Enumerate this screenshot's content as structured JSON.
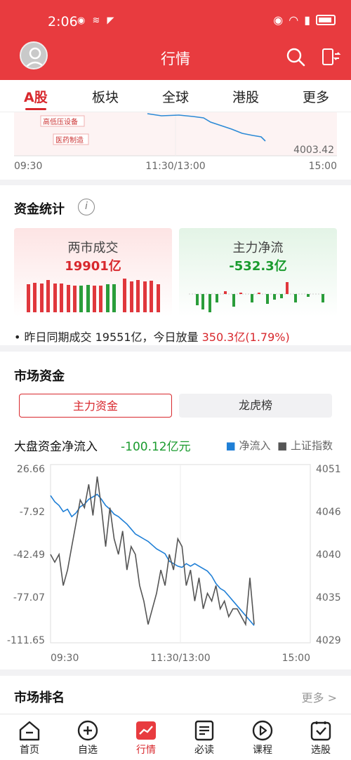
{
  "status_bar": {
    "time": "2:06"
  },
  "header": {
    "title": "行情"
  },
  "tabs": [
    "A股",
    "板块",
    "全球",
    "港股",
    "更多"
  ],
  "top_chart": {
    "tags": [
      "高低压设备",
      "医药制造"
    ],
    "low_label": "4003.42",
    "time_labels": [
      "09:30",
      "11:30/13:00",
      "15:00"
    ]
  },
  "fund_stats": {
    "title": "资金统计",
    "turnover": {
      "label": "两市成交",
      "value": "19901亿"
    },
    "main_flow": {
      "label": "主力净流",
      "value": "-532.3亿"
    },
    "note_prefix": "• 昨日同期成交 19551亿，今日放量 ",
    "note_value": "350.3亿(1.79%)"
  },
  "market_funds": {
    "title": "市场资金",
    "segments": [
      "主力资金",
      "龙虎榜"
    ],
    "chart_title": "大盘资金净流入",
    "chart_value": "-100.12亿元",
    "legend": [
      "净流入",
      "上证指数"
    ]
  },
  "chart_data": {
    "type": "line",
    "y_left_ticks": [
      "26.66",
      "-7.92",
      "-42.49",
      "-77.07",
      "-111.65"
    ],
    "y_right_ticks": [
      "4051",
      "4046",
      "4040",
      "4035",
      "4029"
    ],
    "x_ticks": [
      "09:30",
      "11:30/13:00",
      "15:00"
    ],
    "series": [
      {
        "name": "净流入",
        "color": "#1f7fd6",
        "values": [
          5,
          0,
          -3,
          -8,
          -6,
          -12,
          -9,
          -4,
          -2,
          2,
          4,
          6,
          2,
          -3,
          -6,
          -10,
          -12,
          -15,
          -18,
          -22,
          -26,
          -28,
          -30,
          -32,
          -35,
          -38,
          -40,
          -42,
          -48,
          -50,
          -52,
          -53,
          -50,
          -52,
          -50,
          -52,
          -54,
          -56,
          -60,
          -66,
          -70,
          -72,
          -76,
          -80,
          -84,
          -88,
          -92,
          -96,
          -100
        ]
      },
      {
        "name": "上证指数",
        "color": "#555555",
        "values": [
          4040,
          4039,
          4040,
          4036,
          4038,
          4041,
          4044,
          4047,
          4046,
          4049,
          4045,
          4050,
          4046,
          4041,
          4046,
          4042,
          4040,
          4043,
          4038,
          4041,
          4040,
          4036,
          4034,
          4031,
          4033,
          4035,
          4038,
          4036,
          4040,
          4038,
          4042,
          4041,
          4036,
          4038,
          4034,
          4037,
          4033,
          4035,
          4034,
          4036,
          4033,
          4034,
          4032,
          4033,
          4033,
          4032,
          4031,
          4037,
          4031
        ]
      }
    ]
  },
  "market_rank": {
    "title": "市场排名",
    "more": "更多 >"
  },
  "bottom_nav": [
    "首页",
    "自选",
    "行情",
    "必读",
    "课程",
    "选股"
  ]
}
